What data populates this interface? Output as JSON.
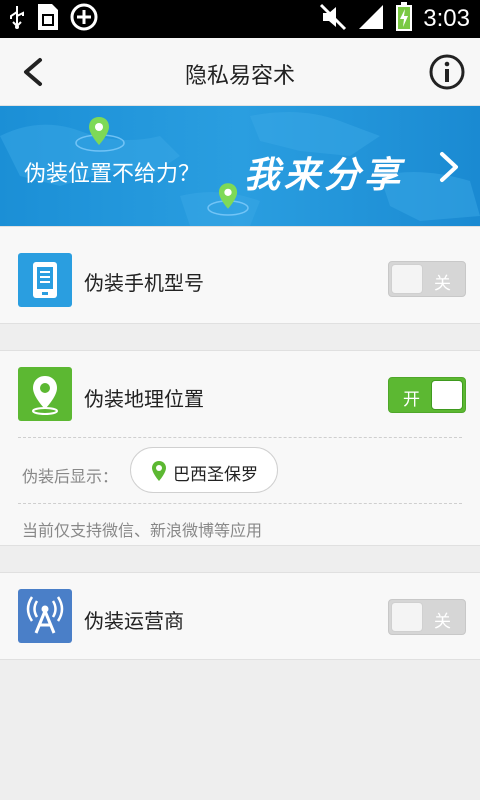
{
  "status_bar": {
    "time": "3:03",
    "left_icons": [
      "usb-icon",
      "sim-card-icon",
      "add-circle-icon"
    ],
    "right_icons": [
      "mute-icon",
      "signal-icon",
      "battery-charging-icon"
    ]
  },
  "header": {
    "title": "隐私易容术",
    "back_icon": "back-arrow-icon",
    "info_icon": "info-icon"
  },
  "banner": {
    "text": "伪装位置不给力？",
    "slogan": "我来分享",
    "arrow_icon": "chevron-right-icon"
  },
  "settings": [
    {
      "id": "phone-model",
      "label": "伪装手机型号",
      "icon": "phone-icon",
      "icon_color": "#2a9ee0",
      "toggle_state": "关",
      "enabled": false
    },
    {
      "id": "location",
      "label": "伪装地理位置",
      "icon": "location-pin-icon",
      "icon_color": "#5cb832",
      "toggle_state": "开",
      "enabled": true,
      "display_label": "伪装后显示：",
      "location_value": "巴西圣保罗",
      "note": "当前仅支持微信、新浪微博等应用"
    },
    {
      "id": "carrier",
      "label": "伪装运营商",
      "icon": "antenna-icon",
      "icon_color": "#4a7fc8",
      "toggle_state": "关",
      "enabled": false
    }
  ],
  "colors": {
    "accent_blue": "#2a9ee0",
    "accent_green": "#5cb832",
    "background": "#eeeeee"
  }
}
